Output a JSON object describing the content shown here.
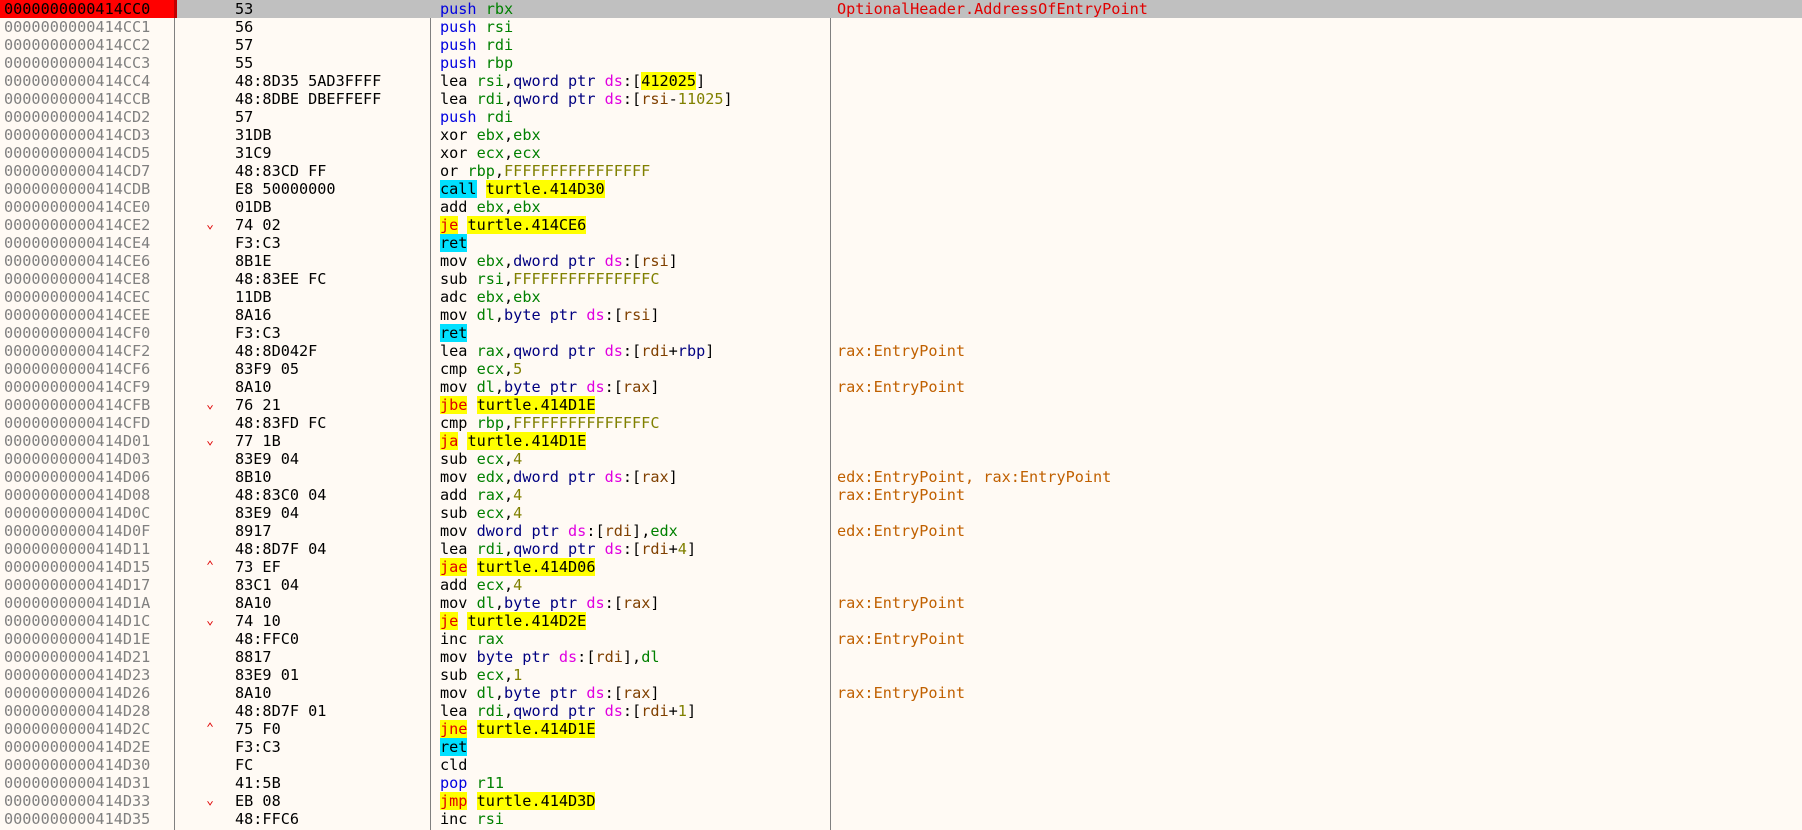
{
  "colors": {
    "selected_row": "#c0c0c0",
    "selected_address": "#ff0000",
    "register": "#008000",
    "mnemonic": "#0000e0",
    "call_highlight": "#00e0ff",
    "jump_highlight": "#ffff00",
    "comment": "#c06000"
  },
  "rows": [
    {
      "addr": "0000000000414CC0",
      "arrow": "",
      "bytes": "53",
      "asm": [
        [
          "ks",
          "push"
        ],
        [
          "kx",
          " "
        ],
        [
          "kr",
          "rbx"
        ]
      ],
      "comment": "OptionalHeader.AddressOfEntryPoint",
      "selected": true
    },
    {
      "addr": "0000000000414CC1",
      "arrow": "",
      "bytes": "56",
      "asm": [
        [
          "ks",
          "push"
        ],
        [
          "kx",
          " "
        ],
        [
          "kr",
          "rsi"
        ]
      ],
      "comment": ""
    },
    {
      "addr": "0000000000414CC2",
      "arrow": "",
      "bytes": "57",
      "asm": [
        [
          "ks",
          "push"
        ],
        [
          "kx",
          " "
        ],
        [
          "kr",
          "rdi"
        ]
      ],
      "comment": ""
    },
    {
      "addr": "0000000000414CC3",
      "arrow": "",
      "bytes": "55",
      "asm": [
        [
          "ks",
          "push"
        ],
        [
          "kx",
          " "
        ],
        [
          "kr",
          "rbp"
        ]
      ],
      "comment": ""
    },
    {
      "addr": "0000000000414CC4",
      "arrow": "",
      "bytes": "48:8D35 5AD3FFFF",
      "asm": [
        [
          "kx",
          "lea "
        ],
        [
          "kr",
          "rsi"
        ],
        [
          "kx",
          ","
        ],
        [
          "kp",
          "qword ptr "
        ],
        [
          "kd",
          "ds"
        ],
        [
          "kx",
          ":["
        ],
        [
          "ka",
          "412025"
        ],
        [
          "kx",
          "]"
        ]
      ],
      "comment": ""
    },
    {
      "addr": "0000000000414CCB",
      "arrow": "",
      "bytes": "48:8DBE DBEFFEFF",
      "asm": [
        [
          "kx",
          "lea "
        ],
        [
          "kr",
          "rdi"
        ],
        [
          "kx",
          ","
        ],
        [
          "kp",
          "qword ptr "
        ],
        [
          "kd",
          "ds"
        ],
        [
          "kx",
          ":["
        ],
        [
          "kb",
          "rsi"
        ],
        [
          "kx",
          "-"
        ],
        [
          "kn",
          "11025"
        ],
        [
          "kx",
          "]"
        ]
      ],
      "comment": ""
    },
    {
      "addr": "0000000000414CD2",
      "arrow": "",
      "bytes": "57",
      "asm": [
        [
          "ks",
          "push"
        ],
        [
          "kx",
          " "
        ],
        [
          "kr",
          "rdi"
        ]
      ],
      "comment": ""
    },
    {
      "addr": "0000000000414CD3",
      "arrow": "",
      "bytes": "31DB",
      "asm": [
        [
          "kx",
          "xor "
        ],
        [
          "kr",
          "ebx"
        ],
        [
          "kx",
          ","
        ],
        [
          "kr",
          "ebx"
        ]
      ],
      "comment": ""
    },
    {
      "addr": "0000000000414CD5",
      "arrow": "",
      "bytes": "31C9",
      "asm": [
        [
          "kx",
          "xor "
        ],
        [
          "kr",
          "ecx"
        ],
        [
          "kx",
          ","
        ],
        [
          "kr",
          "ecx"
        ]
      ],
      "comment": ""
    },
    {
      "addr": "0000000000414CD7",
      "arrow": "",
      "bytes": "48:83CD FF",
      "asm": [
        [
          "kx",
          "or "
        ],
        [
          "kr",
          "rbp"
        ],
        [
          "kx",
          ","
        ],
        [
          "kn",
          "FFFFFFFFFFFFFFFF"
        ]
      ],
      "comment": ""
    },
    {
      "addr": "0000000000414CDB",
      "arrow": "",
      "bytes": "E8 50000000",
      "asm": [
        [
          "kc",
          "call"
        ],
        [
          "kx",
          " "
        ],
        [
          "ka",
          "turtle.414D30"
        ]
      ],
      "comment": ""
    },
    {
      "addr": "0000000000414CE0",
      "arrow": "",
      "bytes": "01DB",
      "asm": [
        [
          "kx",
          "add "
        ],
        [
          "kr",
          "ebx"
        ],
        [
          "kx",
          ","
        ],
        [
          "kr",
          "ebx"
        ]
      ],
      "comment": ""
    },
    {
      "addr": "0000000000414CE2",
      "arrow": "down",
      "bytes": "74 02",
      "asm": [
        [
          "kj",
          "je"
        ],
        [
          "kx",
          " "
        ],
        [
          "ka",
          "turtle.414CE6"
        ]
      ],
      "comment": ""
    },
    {
      "addr": "0000000000414CE4",
      "arrow": "",
      "bytes": "F3:C3",
      "asm": [
        [
          "kc",
          "ret"
        ]
      ],
      "comment": ""
    },
    {
      "addr": "0000000000414CE6",
      "arrow": "",
      "bytes": "8B1E",
      "asm": [
        [
          "kx",
          "mov "
        ],
        [
          "kr",
          "ebx"
        ],
        [
          "kx",
          ","
        ],
        [
          "kp",
          "dword ptr "
        ],
        [
          "kd",
          "ds"
        ],
        [
          "kx",
          ":["
        ],
        [
          "kb",
          "rsi"
        ],
        [
          "kx",
          "]"
        ]
      ],
      "comment": ""
    },
    {
      "addr": "0000000000414CE8",
      "arrow": "",
      "bytes": "48:83EE FC",
      "asm": [
        [
          "kx",
          "sub "
        ],
        [
          "kr",
          "rsi"
        ],
        [
          "kx",
          ","
        ],
        [
          "kn",
          "FFFFFFFFFFFFFFFC"
        ]
      ],
      "comment": ""
    },
    {
      "addr": "0000000000414CEC",
      "arrow": "",
      "bytes": "11DB",
      "asm": [
        [
          "kx",
          "adc "
        ],
        [
          "kr",
          "ebx"
        ],
        [
          "kx",
          ","
        ],
        [
          "kr",
          "ebx"
        ]
      ],
      "comment": ""
    },
    {
      "addr": "0000000000414CEE",
      "arrow": "",
      "bytes": "8A16",
      "asm": [
        [
          "kx",
          "mov "
        ],
        [
          "kr",
          "dl"
        ],
        [
          "kx",
          ","
        ],
        [
          "kp",
          "byte ptr "
        ],
        [
          "kd",
          "ds"
        ],
        [
          "kx",
          ":["
        ],
        [
          "kb",
          "rsi"
        ],
        [
          "kx",
          "]"
        ]
      ],
      "comment": ""
    },
    {
      "addr": "0000000000414CF0",
      "arrow": "",
      "bytes": "F3:C3",
      "asm": [
        [
          "kc",
          "ret"
        ]
      ],
      "comment": ""
    },
    {
      "addr": "0000000000414CF2",
      "arrow": "",
      "bytes": "48:8D042F",
      "asm": [
        [
          "kx",
          "lea "
        ],
        [
          "kr",
          "rax"
        ],
        [
          "kx",
          ","
        ],
        [
          "kp",
          "qword ptr "
        ],
        [
          "kd",
          "ds"
        ],
        [
          "kx",
          ":["
        ],
        [
          "kb",
          "rdi"
        ],
        [
          "kx",
          "+"
        ],
        [
          "kp",
          "rbp"
        ],
        [
          "kx",
          "]"
        ]
      ],
      "comment": "rax:EntryPoint"
    },
    {
      "addr": "0000000000414CF6",
      "arrow": "",
      "bytes": "83F9 05",
      "asm": [
        [
          "kx",
          "cmp "
        ],
        [
          "kr",
          "ecx"
        ],
        [
          "kx",
          ","
        ],
        [
          "kn",
          "5"
        ]
      ],
      "comment": ""
    },
    {
      "addr": "0000000000414CF9",
      "arrow": "",
      "bytes": "8A10",
      "asm": [
        [
          "kx",
          "mov "
        ],
        [
          "kr",
          "dl"
        ],
        [
          "kx",
          ","
        ],
        [
          "kp",
          "byte ptr "
        ],
        [
          "kd",
          "ds"
        ],
        [
          "kx",
          ":["
        ],
        [
          "kb",
          "rax"
        ],
        [
          "kx",
          "]"
        ]
      ],
      "comment": "rax:EntryPoint"
    },
    {
      "addr": "0000000000414CFB",
      "arrow": "down",
      "bytes": "76 21",
      "asm": [
        [
          "kj",
          "jbe"
        ],
        [
          "kx",
          " "
        ],
        [
          "ka",
          "turtle.414D1E"
        ]
      ],
      "comment": ""
    },
    {
      "addr": "0000000000414CFD",
      "arrow": "",
      "bytes": "48:83FD FC",
      "asm": [
        [
          "kx",
          "cmp "
        ],
        [
          "kr",
          "rbp"
        ],
        [
          "kx",
          ","
        ],
        [
          "kn",
          "FFFFFFFFFFFFFFFC"
        ]
      ],
      "comment": ""
    },
    {
      "addr": "0000000000414D01",
      "arrow": "down",
      "bytes": "77 1B",
      "asm": [
        [
          "kj",
          "ja"
        ],
        [
          "kx",
          " "
        ],
        [
          "ka",
          "turtle.414D1E"
        ]
      ],
      "comment": ""
    },
    {
      "addr": "0000000000414D03",
      "arrow": "",
      "bytes": "83E9 04",
      "asm": [
        [
          "kx",
          "sub "
        ],
        [
          "kr",
          "ecx"
        ],
        [
          "kx",
          ","
        ],
        [
          "kn",
          "4"
        ]
      ],
      "comment": ""
    },
    {
      "addr": "0000000000414D06",
      "arrow": "",
      "bytes": "8B10",
      "asm": [
        [
          "kx",
          "mov "
        ],
        [
          "kr",
          "edx"
        ],
        [
          "kx",
          ","
        ],
        [
          "kp",
          "dword ptr "
        ],
        [
          "kd",
          "ds"
        ],
        [
          "kx",
          ":["
        ],
        [
          "kb",
          "rax"
        ],
        [
          "kx",
          "]"
        ]
      ],
      "comment": "edx:EntryPoint, rax:EntryPoint"
    },
    {
      "addr": "0000000000414D08",
      "arrow": "",
      "bytes": "48:83C0 04",
      "asm": [
        [
          "kx",
          "add "
        ],
        [
          "kr",
          "rax"
        ],
        [
          "kx",
          ","
        ],
        [
          "kn",
          "4"
        ]
      ],
      "comment": "rax:EntryPoint"
    },
    {
      "addr": "0000000000414D0C",
      "arrow": "",
      "bytes": "83E9 04",
      "asm": [
        [
          "kx",
          "sub "
        ],
        [
          "kr",
          "ecx"
        ],
        [
          "kx",
          ","
        ],
        [
          "kn",
          "4"
        ]
      ],
      "comment": ""
    },
    {
      "addr": "0000000000414D0F",
      "arrow": "",
      "bytes": "8917",
      "asm": [
        [
          "kx",
          "mov "
        ],
        [
          "kp",
          "dword ptr "
        ],
        [
          "kd",
          "ds"
        ],
        [
          "kx",
          ":["
        ],
        [
          "kb",
          "rdi"
        ],
        [
          "kx",
          "],"
        ],
        [
          "kr",
          "edx"
        ]
      ],
      "comment": "edx:EntryPoint"
    },
    {
      "addr": "0000000000414D11",
      "arrow": "",
      "bytes": "48:8D7F 04",
      "asm": [
        [
          "kx",
          "lea "
        ],
        [
          "kr",
          "rdi"
        ],
        [
          "kx",
          ","
        ],
        [
          "kp",
          "qword ptr "
        ],
        [
          "kd",
          "ds"
        ],
        [
          "kx",
          ":["
        ],
        [
          "kb",
          "rdi"
        ],
        [
          "kx",
          "+"
        ],
        [
          "kn",
          "4"
        ],
        [
          "kx",
          "]"
        ]
      ],
      "comment": ""
    },
    {
      "addr": "0000000000414D15",
      "arrow": "up",
      "bytes": "73 EF",
      "asm": [
        [
          "kj",
          "jae"
        ],
        [
          "kx",
          " "
        ],
        [
          "ka",
          "turtle.414D06"
        ]
      ],
      "comment": ""
    },
    {
      "addr": "0000000000414D17",
      "arrow": "",
      "bytes": "83C1 04",
      "asm": [
        [
          "kx",
          "add "
        ],
        [
          "kr",
          "ecx"
        ],
        [
          "kx",
          ","
        ],
        [
          "kn",
          "4"
        ]
      ],
      "comment": ""
    },
    {
      "addr": "0000000000414D1A",
      "arrow": "",
      "bytes": "8A10",
      "asm": [
        [
          "kx",
          "mov "
        ],
        [
          "kr",
          "dl"
        ],
        [
          "kx",
          ","
        ],
        [
          "kp",
          "byte ptr "
        ],
        [
          "kd",
          "ds"
        ],
        [
          "kx",
          ":["
        ],
        [
          "kb",
          "rax"
        ],
        [
          "kx",
          "]"
        ]
      ],
      "comment": "rax:EntryPoint"
    },
    {
      "addr": "0000000000414D1C",
      "arrow": "down",
      "bytes": "74 10",
      "asm": [
        [
          "kj",
          "je"
        ],
        [
          "kx",
          " "
        ],
        [
          "ka",
          "turtle.414D2E"
        ]
      ],
      "comment": ""
    },
    {
      "addr": "0000000000414D1E",
      "arrow": "",
      "bytes": "48:FFC0",
      "asm": [
        [
          "kx",
          "inc "
        ],
        [
          "kr",
          "rax"
        ]
      ],
      "comment": "rax:EntryPoint"
    },
    {
      "addr": "0000000000414D21",
      "arrow": "",
      "bytes": "8817",
      "asm": [
        [
          "kx",
          "mov "
        ],
        [
          "kp",
          "byte ptr "
        ],
        [
          "kd",
          "ds"
        ],
        [
          "kx",
          ":["
        ],
        [
          "kb",
          "rdi"
        ],
        [
          "kx",
          "],"
        ],
        [
          "kr",
          "dl"
        ]
      ],
      "comment": ""
    },
    {
      "addr": "0000000000414D23",
      "arrow": "",
      "bytes": "83E9 01",
      "asm": [
        [
          "kx",
          "sub "
        ],
        [
          "kr",
          "ecx"
        ],
        [
          "kx",
          ","
        ],
        [
          "kn",
          "1"
        ]
      ],
      "comment": ""
    },
    {
      "addr": "0000000000414D26",
      "arrow": "",
      "bytes": "8A10",
      "asm": [
        [
          "kx",
          "mov "
        ],
        [
          "kr",
          "dl"
        ],
        [
          "kx",
          ","
        ],
        [
          "kp",
          "byte ptr "
        ],
        [
          "kd",
          "ds"
        ],
        [
          "kx",
          ":["
        ],
        [
          "kb",
          "rax"
        ],
        [
          "kx",
          "]"
        ]
      ],
      "comment": "rax:EntryPoint"
    },
    {
      "addr": "0000000000414D28",
      "arrow": "",
      "bytes": "48:8D7F 01",
      "asm": [
        [
          "kx",
          "lea "
        ],
        [
          "kr",
          "rdi"
        ],
        [
          "kx",
          ","
        ],
        [
          "kp",
          "qword ptr "
        ],
        [
          "kd",
          "ds"
        ],
        [
          "kx",
          ":["
        ],
        [
          "kb",
          "rdi"
        ],
        [
          "kx",
          "+"
        ],
        [
          "kn",
          "1"
        ],
        [
          "kx",
          "]"
        ]
      ],
      "comment": ""
    },
    {
      "addr": "0000000000414D2C",
      "arrow": "up",
      "bytes": "75 F0",
      "asm": [
        [
          "kj",
          "jne"
        ],
        [
          "kx",
          " "
        ],
        [
          "ka",
          "turtle.414D1E"
        ]
      ],
      "comment": ""
    },
    {
      "addr": "0000000000414D2E",
      "arrow": "",
      "bytes": "F3:C3",
      "asm": [
        [
          "kc",
          "ret"
        ]
      ],
      "comment": ""
    },
    {
      "addr": "0000000000414D30",
      "arrow": "",
      "bytes": "FC",
      "asm": [
        [
          "kx",
          "cld"
        ]
      ],
      "comment": ""
    },
    {
      "addr": "0000000000414D31",
      "arrow": "",
      "bytes": "41:5B",
      "asm": [
        [
          "ks",
          "pop"
        ],
        [
          "kx",
          " "
        ],
        [
          "kr",
          "r11"
        ]
      ],
      "comment": ""
    },
    {
      "addr": "0000000000414D33",
      "arrow": "down",
      "bytes": "EB 08",
      "asm": [
        [
          "kj",
          "jmp"
        ],
        [
          "kx",
          " "
        ],
        [
          "ka",
          "turtle.414D3D"
        ]
      ],
      "comment": ""
    },
    {
      "addr": "0000000000414D35",
      "arrow": "",
      "bytes": "48:FFC6",
      "asm": [
        [
          "kx",
          "inc "
        ],
        [
          "kr",
          "rsi"
        ]
      ],
      "comment": ""
    }
  ]
}
